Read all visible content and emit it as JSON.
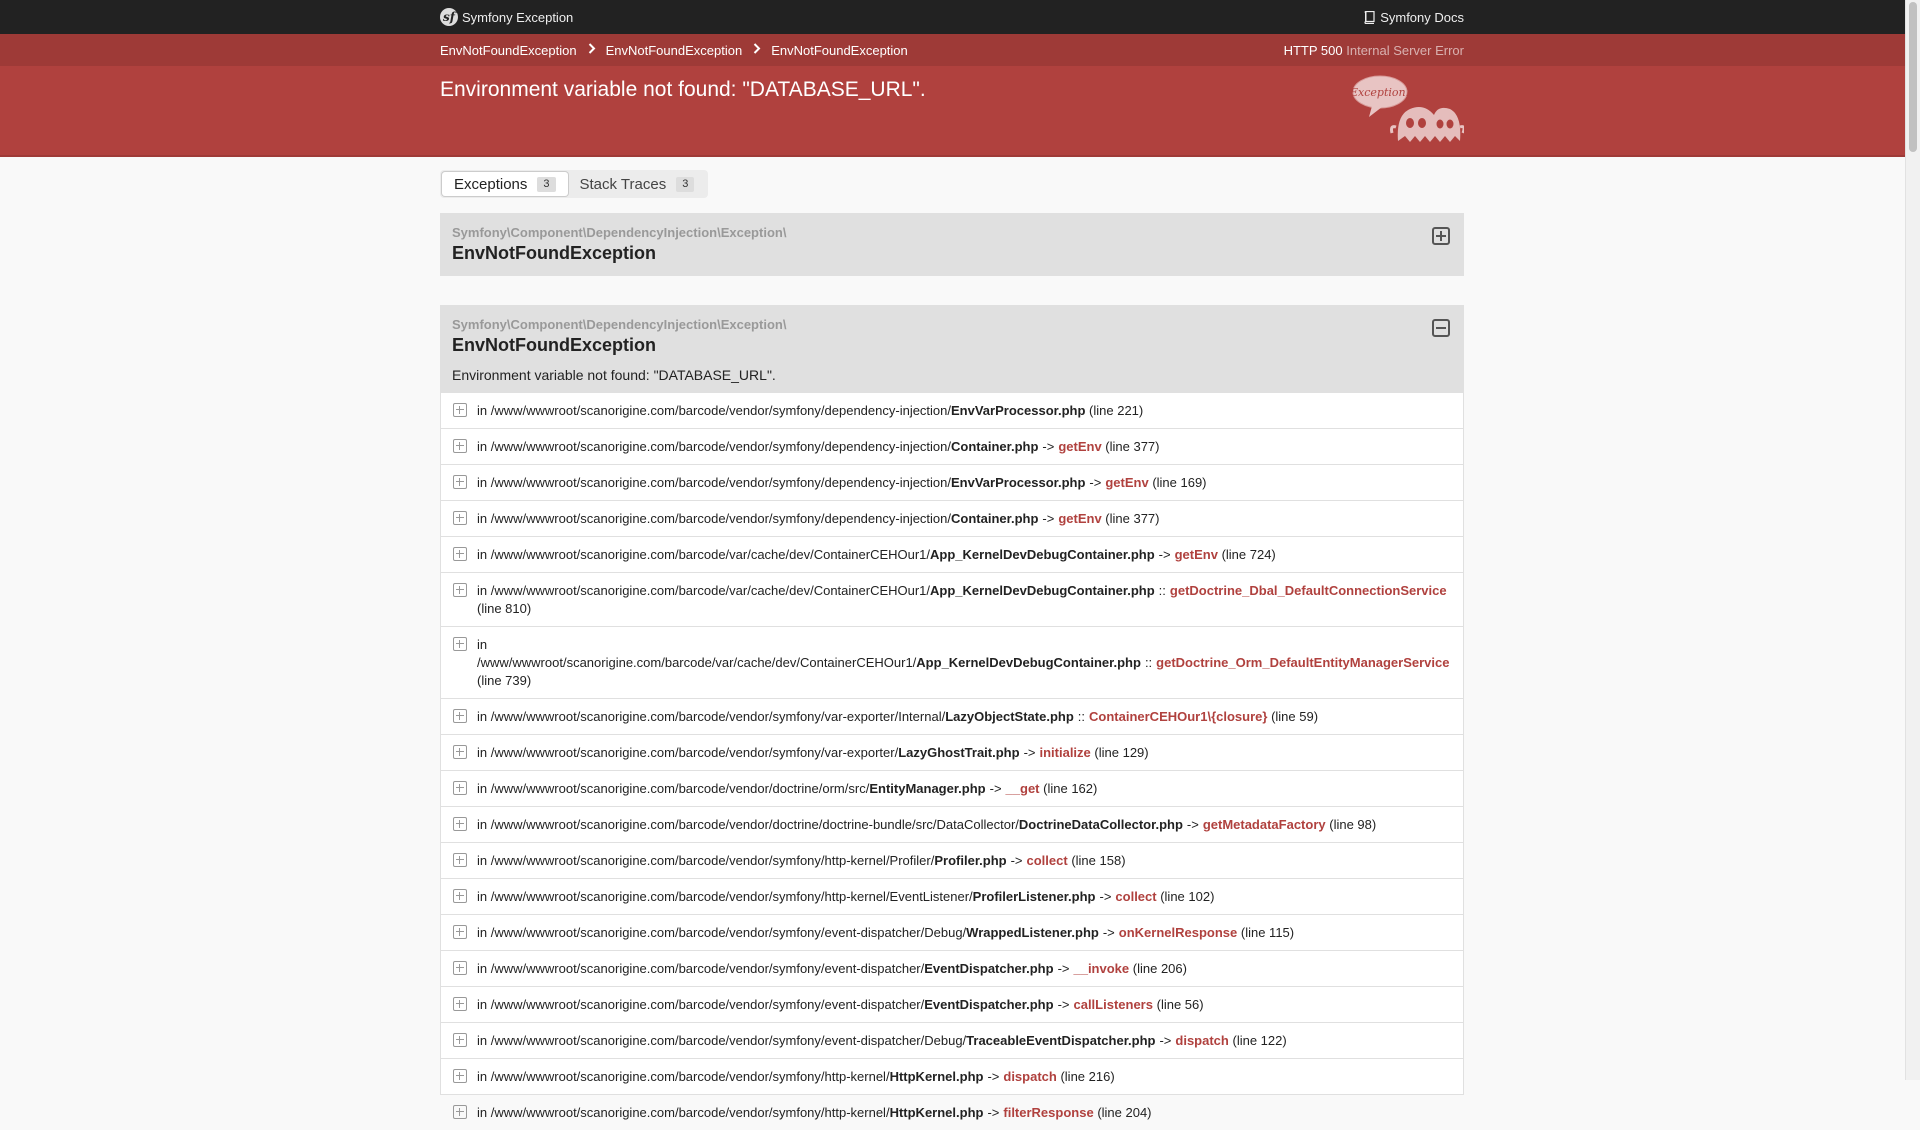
{
  "topbar": {
    "brand": "Symfony Exception",
    "docs": "Symfony Docs"
  },
  "breadcrumbs": [
    "EnvNotFoundException",
    "EnvNotFoundException",
    "EnvNotFoundException"
  ],
  "http_status": {
    "code": "HTTP 500",
    "text": "Internal Server Error"
  },
  "exception_message": "Environment variable not found: \"DATABASE_URL\".",
  "tabs": [
    {
      "label": "Exceptions",
      "count": "3"
    },
    {
      "label": "Stack Traces",
      "count": "3"
    }
  ],
  "traces": [
    {
      "namespace": "Symfony\\Component\\DependencyInjection\\Exception\\",
      "class": "EnvNotFoundException"
    },
    {
      "namespace": "Symfony\\Component\\DependencyInjection\\Exception\\",
      "class": "EnvNotFoundException",
      "message": "Environment variable not found: \"DATABASE_URL\".",
      "lines": [
        {
          "path": "in /www/wwwroot/scanorigine.com/barcode/vendor/symfony/dependency-injection/",
          "file": "EnvVarProcessor.php",
          "op": "",
          "fn": "",
          "line": "(line 221)"
        },
        {
          "path": "in /www/wwwroot/scanorigine.com/barcode/vendor/symfony/dependency-injection/",
          "file": "Container.php",
          "op": "->",
          "fn": "getEnv",
          "line": "(line 377)"
        },
        {
          "path": "in /www/wwwroot/scanorigine.com/barcode/vendor/symfony/dependency-injection/",
          "file": "EnvVarProcessor.php",
          "op": "->",
          "fn": "getEnv",
          "line": "(line 169)"
        },
        {
          "path": "in /www/wwwroot/scanorigine.com/barcode/vendor/symfony/dependency-injection/",
          "file": "Container.php",
          "op": "->",
          "fn": "getEnv",
          "line": "(line 377)"
        },
        {
          "path": "in /www/wwwroot/scanorigine.com/barcode/var/cache/dev/ContainerCEHOur1/",
          "file": "App_KernelDevDebugContainer.php",
          "op": "->",
          "fn": "getEnv",
          "line": "(line 724)"
        },
        {
          "path": "in /www/wwwroot/scanorigine.com/barcode/var/cache/dev/ContainerCEHOur1/",
          "file": "App_KernelDevDebugContainer.php",
          "op": "::",
          "fn": "getDoctrine_Dbal_DefaultConnectionService",
          "line": "(line 810)"
        },
        {
          "path": "in /www/wwwroot/scanorigine.com/barcode/var/cache/dev/ContainerCEHOur1/",
          "file": "App_KernelDevDebugContainer.php",
          "op": "::",
          "fn": "getDoctrine_Orm_DefaultEntityManagerService",
          "line": "(line 739)"
        },
        {
          "path": "in /www/wwwroot/scanorigine.com/barcode/vendor/symfony/var-exporter/Internal/",
          "file": "LazyObjectState.php",
          "op": "::",
          "fn": "ContainerCEHOur1\\{closure}",
          "line": "(line 59)"
        },
        {
          "path": "in /www/wwwroot/scanorigine.com/barcode/vendor/symfony/var-exporter/",
          "file": "LazyGhostTrait.php",
          "op": "->",
          "fn": "initialize",
          "line": "(line 129)"
        },
        {
          "path": "in /www/wwwroot/scanorigine.com/barcode/vendor/doctrine/orm/src/",
          "file": "EntityManager.php",
          "op": "->",
          "fn": "__get",
          "line": "(line 162)"
        },
        {
          "path": "in /www/wwwroot/scanorigine.com/barcode/vendor/doctrine/doctrine-bundle/src/DataCollector/",
          "file": "DoctrineDataCollector.php",
          "op": "->",
          "fn": "getMetadataFactory",
          "line": "(line 98)"
        },
        {
          "path": "in /www/wwwroot/scanorigine.com/barcode/vendor/symfony/http-kernel/Profiler/",
          "file": "Profiler.php",
          "op": "->",
          "fn": "collect",
          "line": "(line 158)"
        },
        {
          "path": "in /www/wwwroot/scanorigine.com/barcode/vendor/symfony/http-kernel/EventListener/",
          "file": "ProfilerListener.php",
          "op": "->",
          "fn": "collect",
          "line": "(line 102)"
        },
        {
          "path": "in /www/wwwroot/scanorigine.com/barcode/vendor/symfony/event-dispatcher/Debug/",
          "file": "WrappedListener.php",
          "op": "->",
          "fn": "onKernelResponse",
          "line": "(line 115)"
        },
        {
          "path": "in /www/wwwroot/scanorigine.com/barcode/vendor/symfony/event-dispatcher/",
          "file": "EventDispatcher.php",
          "op": "->",
          "fn": "__invoke",
          "line": "(line 206)"
        },
        {
          "path": "in /www/wwwroot/scanorigine.com/barcode/vendor/symfony/event-dispatcher/",
          "file": "EventDispatcher.php",
          "op": "->",
          "fn": "callListeners",
          "line": "(line 56)"
        },
        {
          "path": "in /www/wwwroot/scanorigine.com/barcode/vendor/symfony/event-dispatcher/Debug/",
          "file": "TraceableEventDispatcher.php",
          "op": "->",
          "fn": "dispatch",
          "line": "(line 122)"
        },
        {
          "path": "in /www/wwwroot/scanorigine.com/barcode/vendor/symfony/http-kernel/",
          "file": "HttpKernel.php",
          "op": "->",
          "fn": "dispatch",
          "line": "(line 216)"
        },
        {
          "path": "in /www/wwwroot/scanorigine.com/barcode/vendor/symfony/http-kernel/",
          "file": "HttpKernel.php",
          "op": "->",
          "fn": "filterResponse",
          "line": "(line 204)"
        }
      ]
    }
  ],
  "colors": {
    "header_red": "#b0413e",
    "topbar": "#222222",
    "function_red": "#b0413e"
  }
}
